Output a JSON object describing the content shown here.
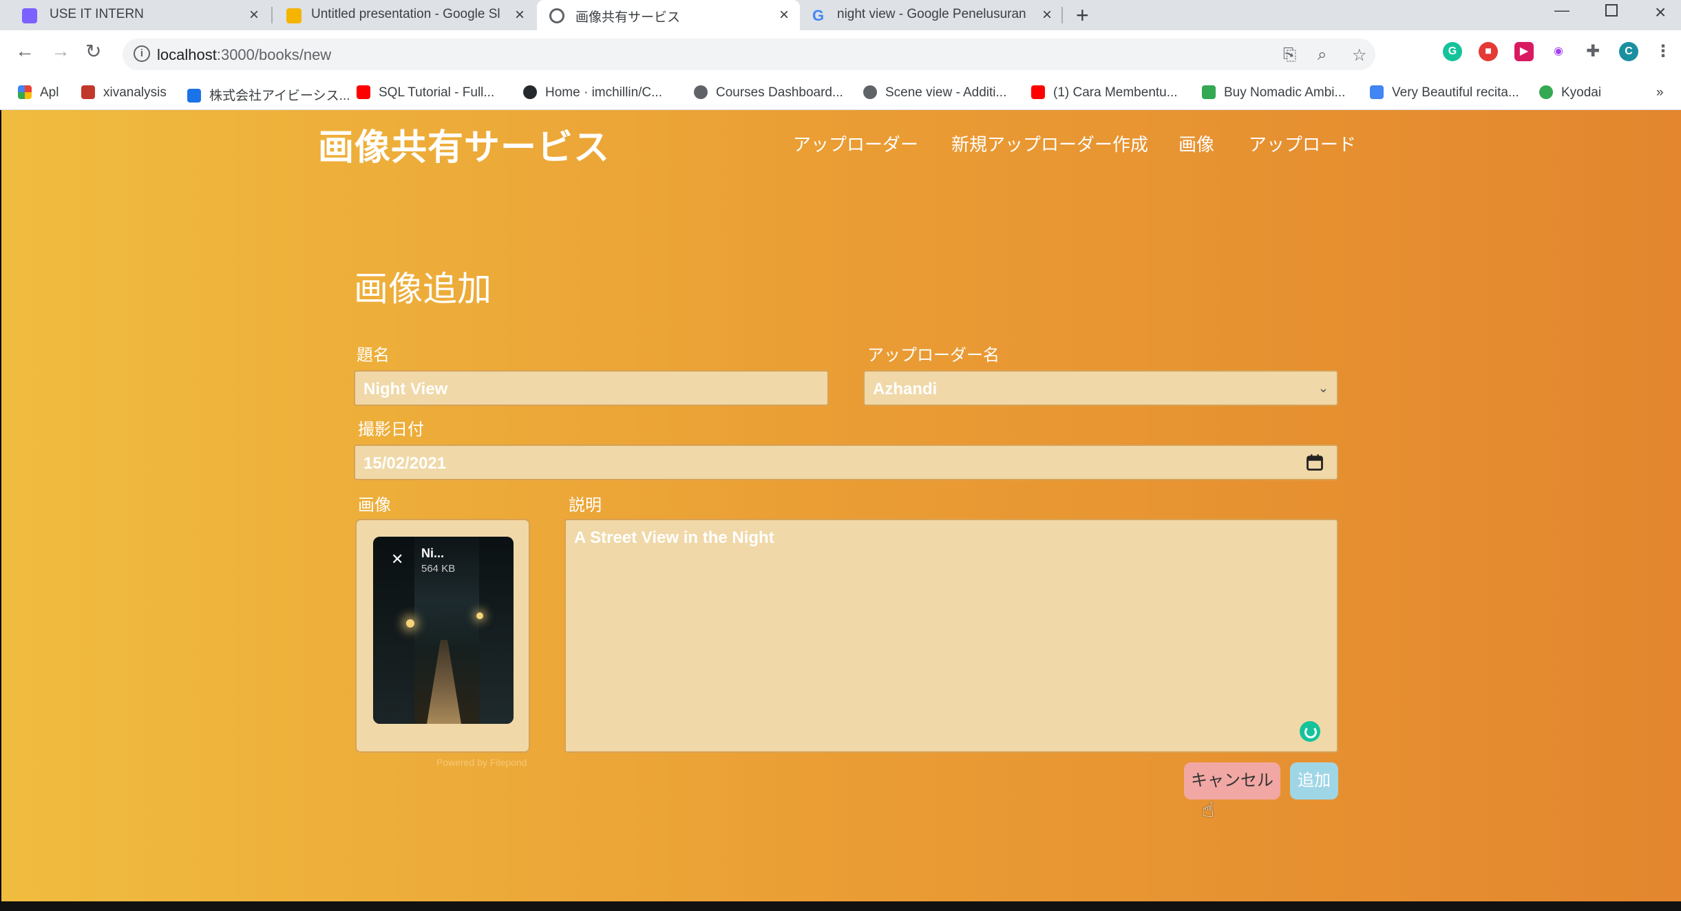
{
  "browser": {
    "tabs": [
      {
        "title": "USE IT INTERN",
        "favicon_color": "#7b61ff"
      },
      {
        "title": "Untitled presentation - Google Sl",
        "favicon_color": "#f4b400"
      },
      {
        "title": "画像共有サービス",
        "favicon_color": "#5f6368"
      },
      {
        "title": "night view - Google Penelusuran",
        "favicon_color": "#4285f4"
      }
    ],
    "new_tab": "+",
    "address": {
      "host": "localhost",
      "path": ":3000/books/new"
    },
    "profile_initial": "C",
    "bookmarks": [
      {
        "label": "Apl",
        "color": "#ea4335"
      },
      {
        "label": "xivanalysis",
        "color": "#c0392b"
      },
      {
        "label": "株式会社アイビーシス...",
        "color": "#1a73e8"
      },
      {
        "label": "SQL Tutorial - Full...",
        "color": "#ff0000"
      },
      {
        "label": "Home · imchillin/C...",
        "color": "#24292e"
      },
      {
        "label": "Courses Dashboard...",
        "color": "#5f6368"
      },
      {
        "label": "Scene view - Additi...",
        "color": "#5f6368"
      },
      {
        "label": "(1) Cara Membentu...",
        "color": "#ff0000"
      },
      {
        "label": "Buy Nomadic Ambi...",
        "color": "#34a853"
      },
      {
        "label": "Very Beautiful recita...",
        "color": "#4285f4"
      },
      {
        "label": "Kyodai",
        "color": "#34a853"
      }
    ]
  },
  "app": {
    "brand": "画像共有サービス",
    "nav": [
      "アップローダー",
      "新規アップローダー作成",
      "画像",
      "アップロード"
    ]
  },
  "form": {
    "heading": "画像追加",
    "title_label": "題名",
    "title_value": "Night View",
    "uploader_label": "アップローダー名",
    "uploader_value": "Azhandi",
    "date_label": "撮影日付",
    "date_value": "15/02/2021",
    "image_label": "画像",
    "description_label": "説明",
    "description_value": "A Street View in the Night",
    "file": {
      "name": "Ni...",
      "size": "564 KB"
    },
    "powered_by": "Powered by Filepond",
    "cancel_label": "キャンセル",
    "submit_label": "追加"
  },
  "colors": {
    "gradient_start": "#f0bc3f",
    "gradient_end": "#e3862e",
    "field_bg": "#f0d8a8",
    "cancel_bg": "#f1a7a3",
    "submit_bg": "#9fd6e6"
  }
}
